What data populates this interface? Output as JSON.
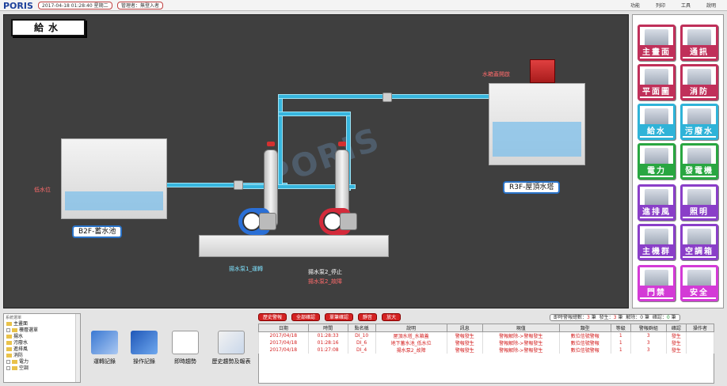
{
  "topbar": {
    "logo": "PORIS",
    "datetime": "2017-04-18 01:28:40 星期二",
    "manager": "管理者：無登入者",
    "menu": [
      "功能",
      "列印",
      "工具",
      "說明"
    ]
  },
  "page": {
    "title": "給水",
    "watermark": "PORIS"
  },
  "diagram": {
    "tank_b2f": "B2F-蓄水池",
    "tank_r3f": "R3F-屋頂水塔",
    "low_level": "低水位",
    "lid_open": "水箱蓋開啟",
    "pump1_status": "揚水泵1_運轉",
    "pump2_status": "揚水泵2_停止",
    "pump2_fault": "揚水泵2_故障"
  },
  "nav": {
    "items": [
      {
        "label": "主畫面",
        "color": "#c0305a"
      },
      {
        "label": "通訊",
        "color": "#c0305a"
      },
      {
        "label": "平面圖",
        "color": "#c0305a"
      },
      {
        "label": "消防",
        "color": "#c0305a"
      },
      {
        "label": "給水",
        "color": "#2fb3d8"
      },
      {
        "label": "污廢水",
        "color": "#2fb3d8"
      },
      {
        "label": "電力",
        "color": "#29a641"
      },
      {
        "label": "發電機",
        "color": "#29a641"
      },
      {
        "label": "進排風",
        "color": "#8a3fc8"
      },
      {
        "label": "照明",
        "color": "#8a3fc8"
      },
      {
        "label": "主機群",
        "color": "#8a3fc8"
      },
      {
        "label": "空調箱",
        "color": "#8a3fc8"
      },
      {
        "label": "門禁",
        "color": "#d33bd6"
      },
      {
        "label": "安全",
        "color": "#d33bd6"
      }
    ]
  },
  "tree": {
    "title": "系統選單",
    "items": [
      "主畫面",
      "樓層選單",
      "揚水",
      "污廢水",
      "進排風",
      "消防",
      "電力",
      "空調"
    ]
  },
  "tools": [
    "運轉記錄",
    "操作記錄",
    "即時趨勢",
    "歷史趨勢及報表"
  ],
  "alarm": {
    "buttons": [
      "歷史警報",
      "全部確認",
      "單筆確認",
      "靜音",
      "放大"
    ],
    "stats": {
      "label_total": "即時警報總數：",
      "total": "3",
      "unit1": "筆",
      "label_occur": "發生：",
      "occur": "3",
      "unit2": "筆",
      "label_clear": "解除：",
      "clear": "0",
      "unit3": "筆",
      "label_ack": "確認：",
      "ack": "0",
      "unit4": "筆"
    },
    "columns": [
      "日期",
      "時間",
      "點名稱",
      "說明",
      "訊息",
      "現值",
      "類型",
      "等級",
      "警報群組",
      "確認",
      "操作者"
    ],
    "rows": [
      [
        "2017/04/18",
        "01:28:33",
        "DI_10",
        "屋頂水塔_水箱蓋",
        "警報發生",
        "警報解除->警報發生",
        "數位信號警報",
        "1",
        "3",
        "發生",
        ""
      ],
      [
        "2017/04/18",
        "01:28:16",
        "DI_6",
        "地下蓄水池_低水位",
        "警報發生",
        "警報解除->警報發生",
        "數位信號警報",
        "1",
        "3",
        "發生",
        ""
      ],
      [
        "2017/04/18",
        "01:27:08",
        "DI_4",
        "揚水泵2_故障",
        "警報發生",
        "警報解除->警報發生",
        "數位信號警報",
        "1",
        "3",
        "發生",
        ""
      ]
    ]
  }
}
